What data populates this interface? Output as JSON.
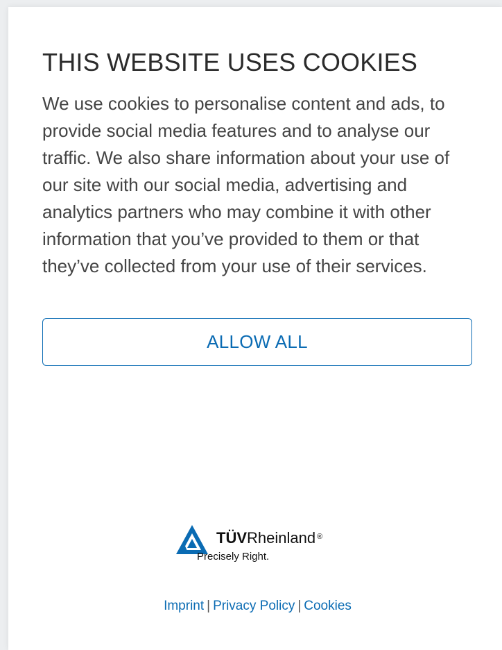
{
  "dialog": {
    "title": "THIS WEBSITE USES COOKIES",
    "body": "We use cookies to personalise content and ads, to provide social media features and to analyse our traffic. We also share information about your use of our site with our social media, advertising and analytics partners who may combine it with other information that you’ve provided to them or that they’ve collected from your use of their services.",
    "allow_all_label": "ALLOW ALL"
  },
  "logo": {
    "brand_bold": "TÜV",
    "brand_regular": "Rheinland",
    "registered": "®",
    "tagline": "Precisely Right.",
    "icon": "tuv-triangle-logo-icon"
  },
  "footer": {
    "links": [
      "Imprint",
      "Privacy Policy",
      "Cookies"
    ],
    "separator": "|"
  },
  "colors": {
    "accent": "#0a6bb3",
    "text": "#444444",
    "title": "#2b2b2b",
    "background": "#ffffff"
  }
}
